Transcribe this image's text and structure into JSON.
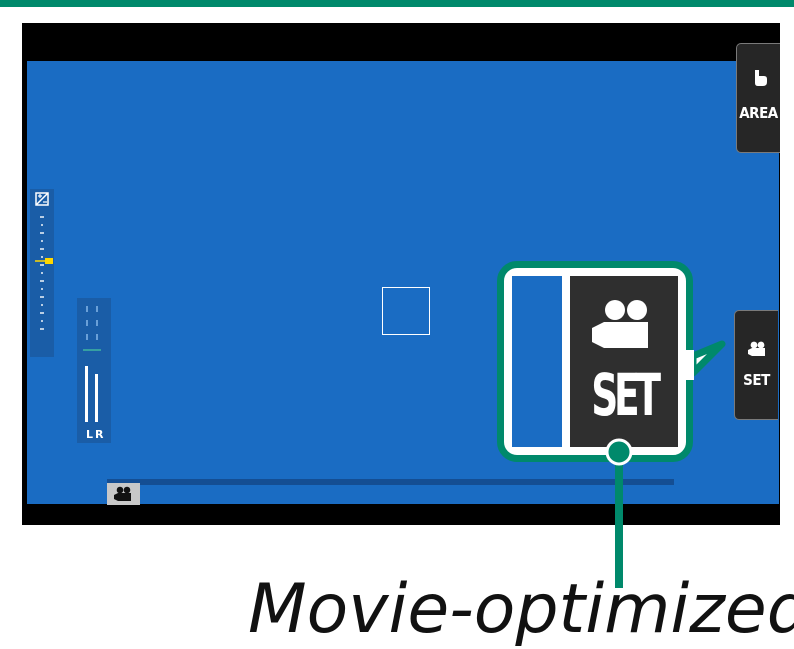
{
  "camera_display": {
    "focus_area_button": {
      "label": "AREA",
      "icon": "touch-hand-icon"
    },
    "set_button": {
      "label": "SET",
      "icon": "movie-camera-icon"
    },
    "exposure_scale": {
      "icon": "exposure-compensation-icon"
    },
    "audio_meter": {
      "label": "LR"
    },
    "mode_indicator": {
      "icon": "movie-camera-icon"
    }
  },
  "callout": {
    "label": "SET",
    "icon": "movie-camera-icon"
  },
  "caption": {
    "text": "Movie-optimized"
  },
  "colors": {
    "accent": "#00896b",
    "viewfinder": "#1a6cc3",
    "button": "#262626",
    "level_marker": "#ffd700"
  }
}
